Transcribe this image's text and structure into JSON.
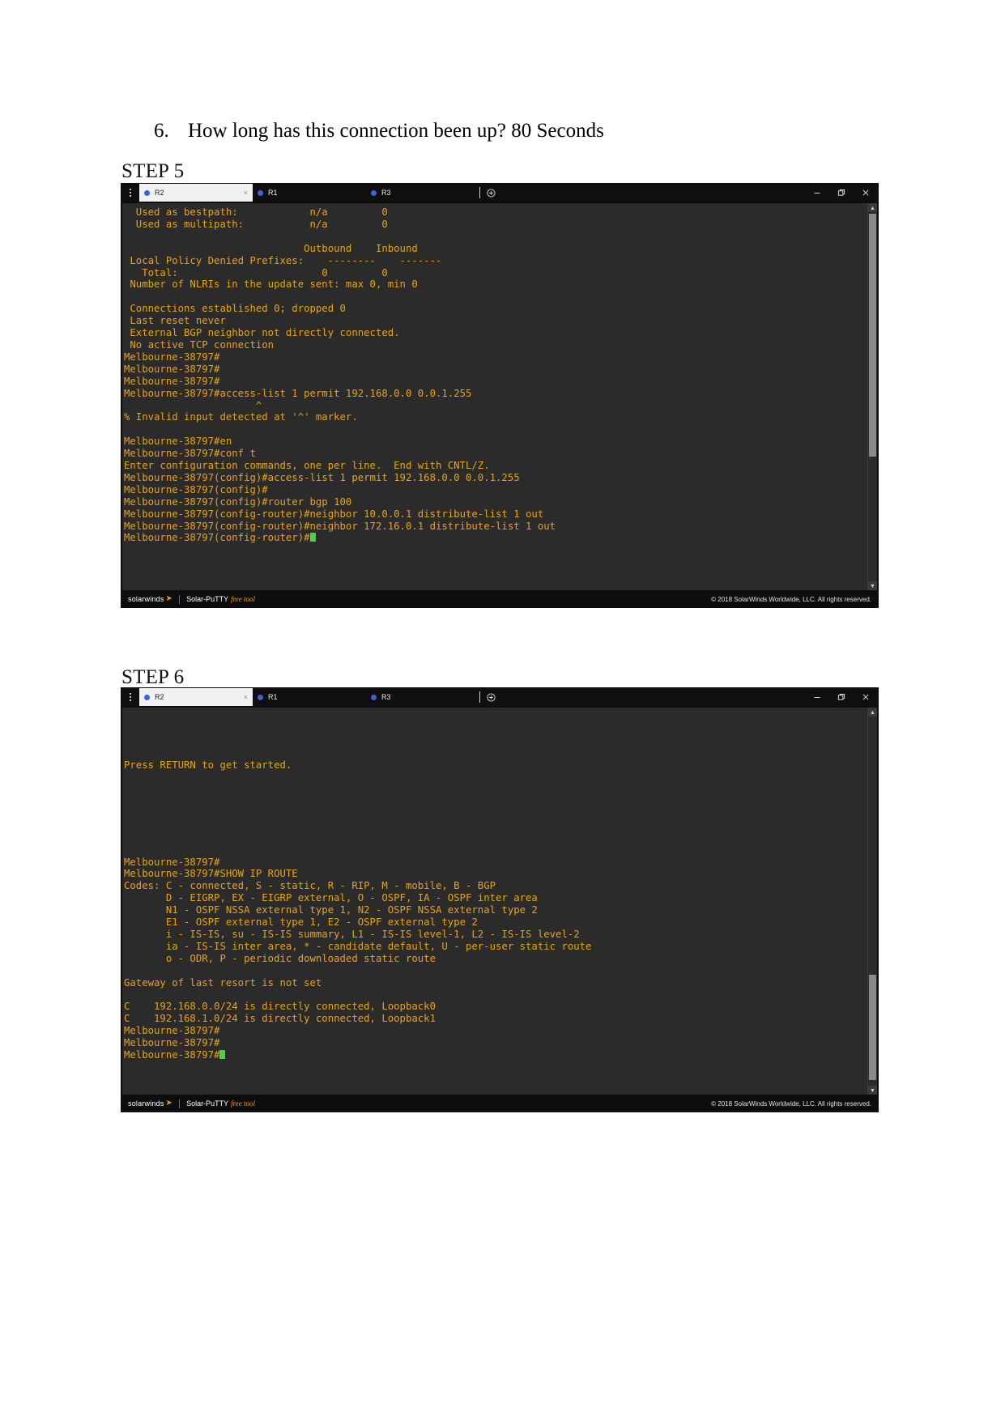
{
  "document": {
    "question": {
      "number": "6.",
      "text": "How long has this connection been up? 80 Seconds"
    },
    "step5_label": "STEP 5",
    "step6_label": "STEP 6"
  },
  "window": {
    "tabs": [
      {
        "label": "R2",
        "active": true,
        "dot_color": "#3b63d8",
        "close": "×"
      },
      {
        "label": "R1",
        "active": false,
        "dot_color": "#3b63d8"
      },
      {
        "label": "R3",
        "active": false,
        "dot_color": "#3b63d8"
      }
    ],
    "new_tab_title": "+",
    "controls": {
      "minimize": "minimize",
      "maximize": "maximize",
      "close": "close"
    },
    "footer": {
      "brand": "solarwinds",
      "product": "Solar-PuTTY",
      "free": "free tool",
      "copyright": "© 2018 SolarWinds Worldwide, LLC. All rights reserved."
    },
    "colors": {
      "terminal_bg": "#2b2b2b",
      "terminal_fg": "#e8a317",
      "chrome_bg": "#0d0d0d",
      "tab_active_bg": "#f1f1f1",
      "tab_dot": "#3b63d8",
      "cursor": "#4ad14a",
      "accent_orange": "#f59b14"
    }
  },
  "terminal_step5": {
    "prompt": "Melbourne-38797",
    "lines": "  Used as bestpath:            n/a         0\n  Used as multipath:           n/a         0\n\n                              Outbound    Inbound\n Local Policy Denied Prefixes:    --------    -------\n   Total:                        0         0\n Number of NLRIs in the update sent: max 0, min 0\n\n Connections established 0; dropped 0\n Last reset never\n External BGP neighbor not directly connected.\n No active TCP connection\nMelbourne-38797#\nMelbourne-38797#\nMelbourne-38797#\nMelbourne-38797#access-list 1 permit 192.168.0.0 0.0.1.255\n                      ^\n% Invalid input detected at '^' marker.\n\nMelbourne-38797#en\nMelbourne-38797#conf t\nEnter configuration commands, one per line.  End with CNTL/Z.\nMelbourne-38797(config)#access-list 1 permit 192.168.0.0 0.0.1.255\nMelbourne-38797(config)#\nMelbourne-38797(config)#router bgp 100\nMelbourne-38797(config-router)#neighbor 10.0.0.1 distribute-list 1 out\nMelbourne-38797(config-router)#neighbor 172.16.0.1 distribute-list 1 out\nMelbourne-38797(config-router)#"
  },
  "terminal_step6": {
    "prompt": "Melbourne-38797",
    "lines_top": "\n\n\n\nPress RETURN to get started.",
    "lines": "Melbourne-38797#\nMelbourne-38797#SHOW IP ROUTE\nCodes: C - connected, S - static, R - RIP, M - mobile, B - BGP\n       D - EIGRP, EX - EIGRP external, O - OSPF, IA - OSPF inter area\n       N1 - OSPF NSSA external type 1, N2 - OSPF NSSA external type 2\n       E1 - OSPF external type 1, E2 - OSPF external type 2\n       i - IS-IS, su - IS-IS summary, L1 - IS-IS level-1, L2 - IS-IS level-2\n       ia - IS-IS inter area, * - candidate default, U - per-user static route\n       o - ODR, P - periodic downloaded static route\n\nGateway of last resort is not set\n\nC    192.168.0.0/24 is directly connected, Loopback0\nC    192.168.1.0/24 is directly connected, Loopback1\nMelbourne-38797#\nMelbourne-38797#\nMelbourne-38797#"
  }
}
